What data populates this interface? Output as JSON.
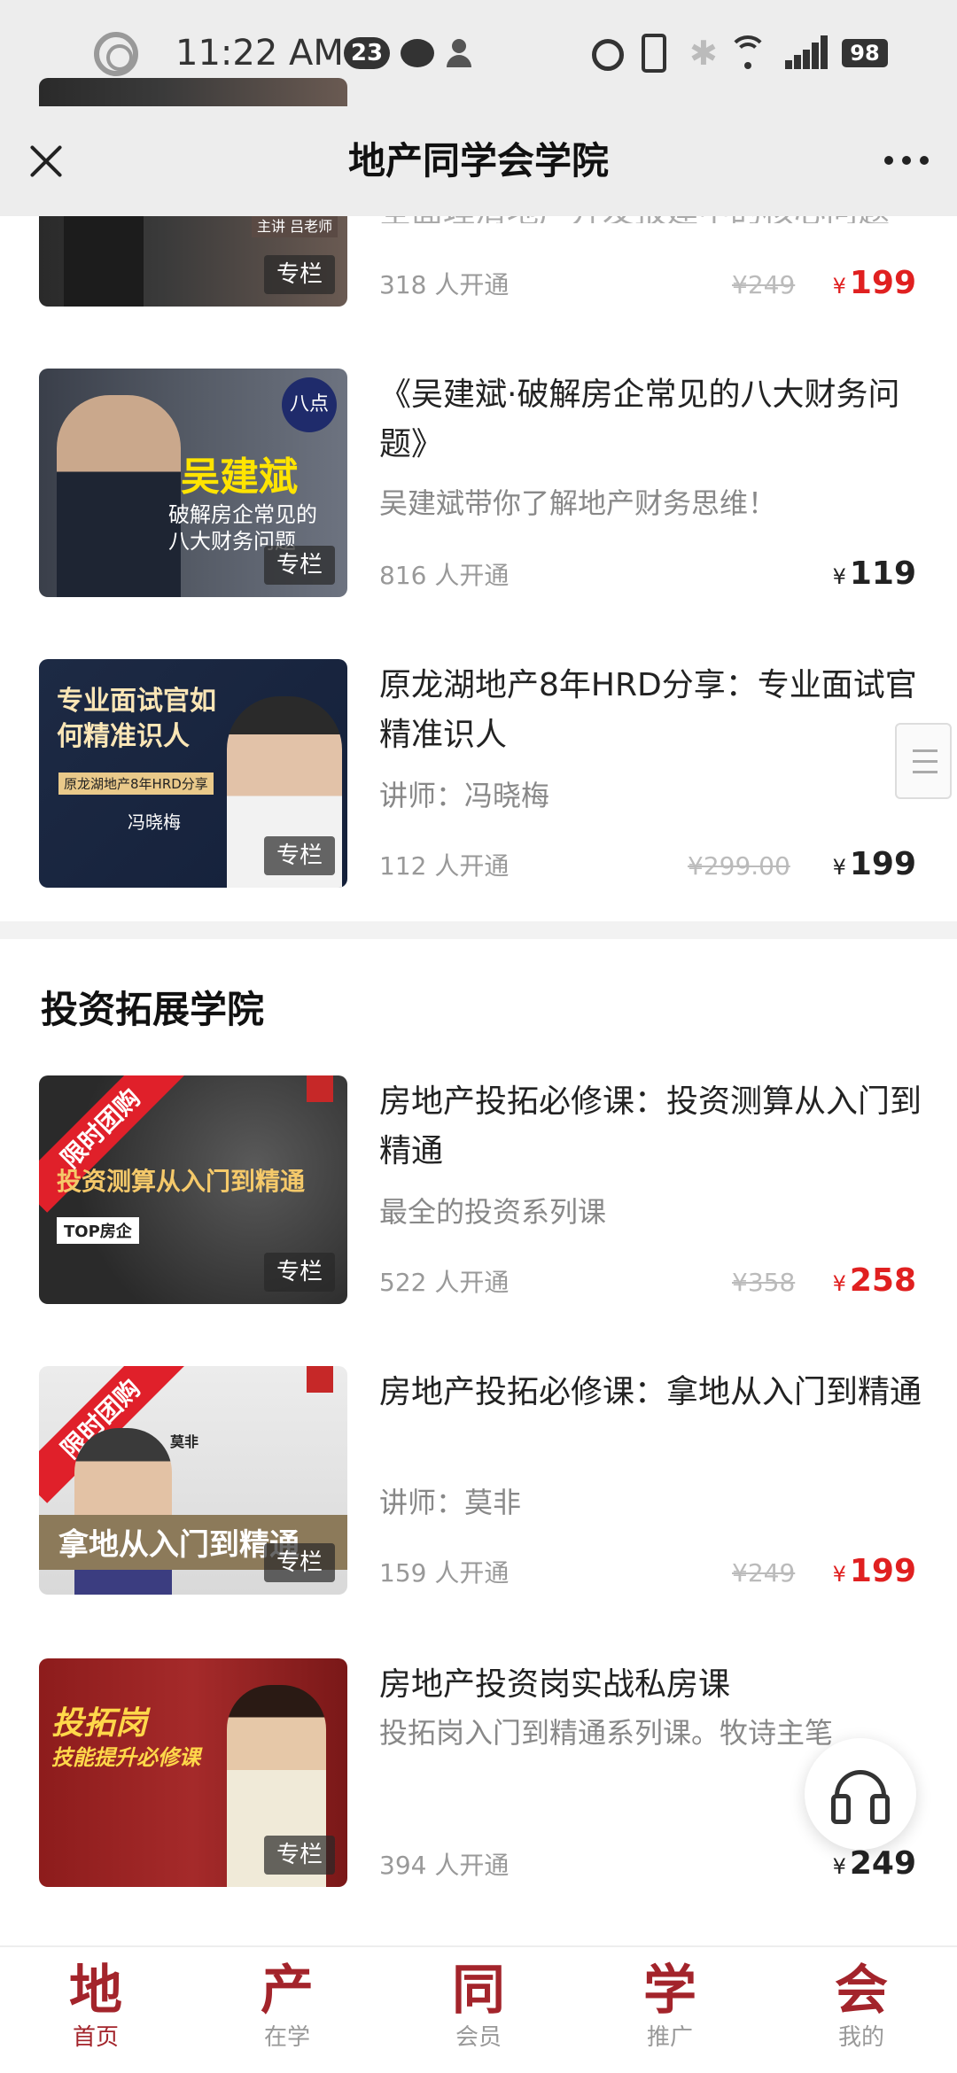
{
  "status_bar": {
    "time": "11:22 AM",
    "notification_count": "23",
    "battery": "98"
  },
  "header": {
    "title": "地产同学会学院"
  },
  "courses_top": [
    {
      "title": "全面理清地产开发报建中的核心问题",
      "subtitle": "",
      "enrolled": "318 人开通",
      "old_price": "¥249",
      "price": "199",
      "price_color": "#e02020",
      "tag": "专栏",
      "thumb_text": "主讲 吕老师"
    },
    {
      "title": "《吴建斌·破解房企常见的八大财务问题》",
      "subtitle": "吴建斌带你了解地产财务思维！",
      "enrolled": "816 人开通",
      "old_price": "",
      "price": "119",
      "price_color": "#222222",
      "tag": "专栏",
      "thumb_text": "吴建斌",
      "thumb_sub": "破解房企常见的八大财务问题",
      "thumb_badge": "八点"
    },
    {
      "title": "原龙湖地产8年HRD分享：专业面试官精准识人",
      "subtitle": "讲师：冯晓梅",
      "enrolled": "112 人开通",
      "old_price": "¥299.00",
      "price": "199",
      "price_color": "#222222",
      "tag": "专栏",
      "thumb_text": "专业面试官如何精准识人",
      "thumb_sub": "原龙湖地产8年HRD分享",
      "thumb_name": "冯晓梅"
    }
  ],
  "section": {
    "title": "投资拓展学院"
  },
  "courses_invest": [
    {
      "title": "房地产投拓必修课：投资测算从入门到精通",
      "subtitle": "最全的投资系列课",
      "enrolled": "522 人开通",
      "old_price": "¥358",
      "price": "258",
      "price_color": "#e02020",
      "tag": "专栏",
      "ribbon": "限时团购",
      "thumb_text": "投资测算从入门到精通",
      "thumb_sub": "TOP房企"
    },
    {
      "title": "房地产投拓必修课：拿地从入门到精通",
      "subtitle": "讲师：莫非",
      "enrolled": "159 人开通",
      "old_price": "¥249",
      "price": "199",
      "price_color": "#e02020",
      "tag": "专栏",
      "ribbon": "限时团购",
      "thumb_text": "拿地从入门到精通",
      "thumb_name": "莫非"
    },
    {
      "title": "房地产投资岗实战私房课",
      "subtitle": "投拓岗入门到精通系列课。牧诗主笔",
      "enrolled": "394 人开通",
      "old_price": "",
      "price": "249",
      "price_color": "#222222",
      "tag": "专栏",
      "thumb_text": "投拓岗",
      "thumb_sub": "技能提升必修课"
    }
  ],
  "currency_symbol": "¥",
  "bottom_nav": [
    {
      "big": "地",
      "small": "首页",
      "active": true
    },
    {
      "big": "产",
      "small": "在学",
      "active": false
    },
    {
      "big": "同",
      "small": "会员",
      "active": false
    },
    {
      "big": "学",
      "small": "推广",
      "active": false
    },
    {
      "big": "会",
      "small": "我的",
      "active": false
    }
  ],
  "colors": {
    "accent_red": "#e02020",
    "brand_dark_red": "#a3242b"
  }
}
